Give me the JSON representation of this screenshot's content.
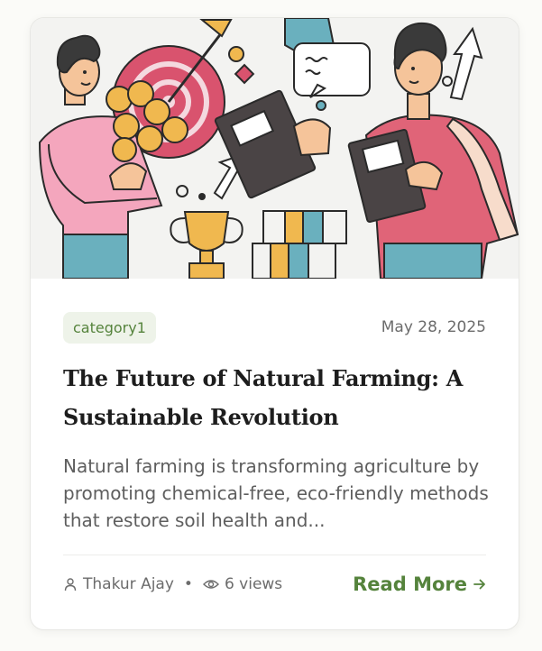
{
  "post": {
    "category": "category1",
    "date": "May 28, 2025",
    "title": "The Future of Natural Farming: A Sustainable Revolution",
    "excerpt": "Natural farming is transforming agriculture by promoting chemical-free, eco-friendly methods that restore soil health and...",
    "author": "Thakur Ajay",
    "separator": "•",
    "views": "6 views",
    "read_more": "Read More"
  },
  "icons": {
    "author": "user-icon",
    "views": "eye-icon",
    "read_more": "arrow-right-icon"
  },
  "colors": {
    "accent": "#55833c",
    "badge_bg": "#eef3e9",
    "title": "#1d1d1d",
    "muted": "#6c6c6c"
  }
}
